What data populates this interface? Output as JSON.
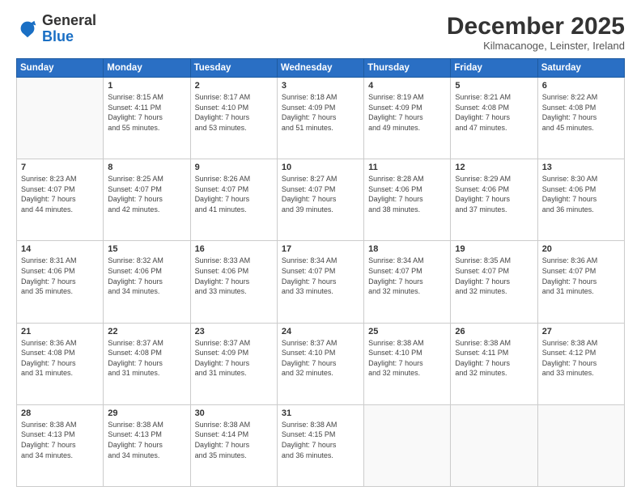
{
  "logo": {
    "general": "General",
    "blue": "Blue"
  },
  "header": {
    "month": "December 2025",
    "location": "Kilmacanoge, Leinster, Ireland"
  },
  "days_of_week": [
    "Sunday",
    "Monday",
    "Tuesday",
    "Wednesday",
    "Thursday",
    "Friday",
    "Saturday"
  ],
  "weeks": [
    [
      {
        "day": "",
        "info": ""
      },
      {
        "day": "1",
        "info": "Sunrise: 8:15 AM\nSunset: 4:11 PM\nDaylight: 7 hours\nand 55 minutes."
      },
      {
        "day": "2",
        "info": "Sunrise: 8:17 AM\nSunset: 4:10 PM\nDaylight: 7 hours\nand 53 minutes."
      },
      {
        "day": "3",
        "info": "Sunrise: 8:18 AM\nSunset: 4:09 PM\nDaylight: 7 hours\nand 51 minutes."
      },
      {
        "day": "4",
        "info": "Sunrise: 8:19 AM\nSunset: 4:09 PM\nDaylight: 7 hours\nand 49 minutes."
      },
      {
        "day": "5",
        "info": "Sunrise: 8:21 AM\nSunset: 4:08 PM\nDaylight: 7 hours\nand 47 minutes."
      },
      {
        "day": "6",
        "info": "Sunrise: 8:22 AM\nSunset: 4:08 PM\nDaylight: 7 hours\nand 45 minutes."
      }
    ],
    [
      {
        "day": "7",
        "info": "Sunrise: 8:23 AM\nSunset: 4:07 PM\nDaylight: 7 hours\nand 44 minutes."
      },
      {
        "day": "8",
        "info": "Sunrise: 8:25 AM\nSunset: 4:07 PM\nDaylight: 7 hours\nand 42 minutes."
      },
      {
        "day": "9",
        "info": "Sunrise: 8:26 AM\nSunset: 4:07 PM\nDaylight: 7 hours\nand 41 minutes."
      },
      {
        "day": "10",
        "info": "Sunrise: 8:27 AM\nSunset: 4:07 PM\nDaylight: 7 hours\nand 39 minutes."
      },
      {
        "day": "11",
        "info": "Sunrise: 8:28 AM\nSunset: 4:06 PM\nDaylight: 7 hours\nand 38 minutes."
      },
      {
        "day": "12",
        "info": "Sunrise: 8:29 AM\nSunset: 4:06 PM\nDaylight: 7 hours\nand 37 minutes."
      },
      {
        "day": "13",
        "info": "Sunrise: 8:30 AM\nSunset: 4:06 PM\nDaylight: 7 hours\nand 36 minutes."
      }
    ],
    [
      {
        "day": "14",
        "info": "Sunrise: 8:31 AM\nSunset: 4:06 PM\nDaylight: 7 hours\nand 35 minutes."
      },
      {
        "day": "15",
        "info": "Sunrise: 8:32 AM\nSunset: 4:06 PM\nDaylight: 7 hours\nand 34 minutes."
      },
      {
        "day": "16",
        "info": "Sunrise: 8:33 AM\nSunset: 4:06 PM\nDaylight: 7 hours\nand 33 minutes."
      },
      {
        "day": "17",
        "info": "Sunrise: 8:34 AM\nSunset: 4:07 PM\nDaylight: 7 hours\nand 33 minutes."
      },
      {
        "day": "18",
        "info": "Sunrise: 8:34 AM\nSunset: 4:07 PM\nDaylight: 7 hours\nand 32 minutes."
      },
      {
        "day": "19",
        "info": "Sunrise: 8:35 AM\nSunset: 4:07 PM\nDaylight: 7 hours\nand 32 minutes."
      },
      {
        "day": "20",
        "info": "Sunrise: 8:36 AM\nSunset: 4:07 PM\nDaylight: 7 hours\nand 31 minutes."
      }
    ],
    [
      {
        "day": "21",
        "info": "Sunrise: 8:36 AM\nSunset: 4:08 PM\nDaylight: 7 hours\nand 31 minutes."
      },
      {
        "day": "22",
        "info": "Sunrise: 8:37 AM\nSunset: 4:08 PM\nDaylight: 7 hours\nand 31 minutes."
      },
      {
        "day": "23",
        "info": "Sunrise: 8:37 AM\nSunset: 4:09 PM\nDaylight: 7 hours\nand 31 minutes."
      },
      {
        "day": "24",
        "info": "Sunrise: 8:37 AM\nSunset: 4:10 PM\nDaylight: 7 hours\nand 32 minutes."
      },
      {
        "day": "25",
        "info": "Sunrise: 8:38 AM\nSunset: 4:10 PM\nDaylight: 7 hours\nand 32 minutes."
      },
      {
        "day": "26",
        "info": "Sunrise: 8:38 AM\nSunset: 4:11 PM\nDaylight: 7 hours\nand 32 minutes."
      },
      {
        "day": "27",
        "info": "Sunrise: 8:38 AM\nSunset: 4:12 PM\nDaylight: 7 hours\nand 33 minutes."
      }
    ],
    [
      {
        "day": "28",
        "info": "Sunrise: 8:38 AM\nSunset: 4:13 PM\nDaylight: 7 hours\nand 34 minutes."
      },
      {
        "day": "29",
        "info": "Sunrise: 8:38 AM\nSunset: 4:13 PM\nDaylight: 7 hours\nand 34 minutes."
      },
      {
        "day": "30",
        "info": "Sunrise: 8:38 AM\nSunset: 4:14 PM\nDaylight: 7 hours\nand 35 minutes."
      },
      {
        "day": "31",
        "info": "Sunrise: 8:38 AM\nSunset: 4:15 PM\nDaylight: 7 hours\nand 36 minutes."
      },
      {
        "day": "",
        "info": ""
      },
      {
        "day": "",
        "info": ""
      },
      {
        "day": "",
        "info": ""
      }
    ]
  ]
}
